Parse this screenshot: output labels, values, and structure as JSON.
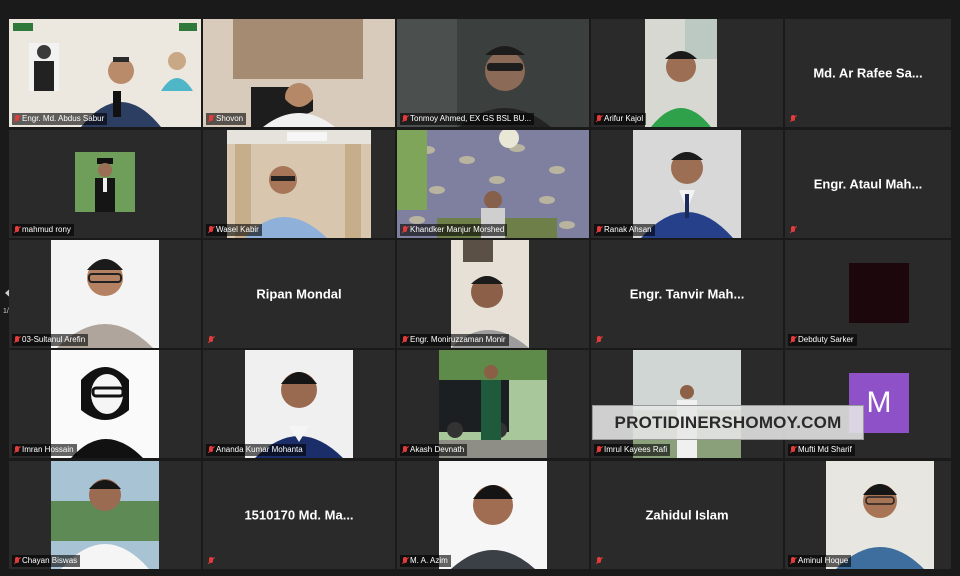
{
  "pager": {
    "page_indicator": "1/2"
  },
  "watermark": "PROTIDINERSHOMOY.COM",
  "tiles": [
    {
      "name": "Engr. Md. Abdus Sabur",
      "speaking": true
    },
    {
      "name": "Shovon"
    },
    {
      "name": "Tonmoy Ahmed, EX GS BSL BU..."
    },
    {
      "name": "Arifur Kajol"
    },
    {
      "name": "Md. Ar Rafee Sa..."
    },
    {
      "name": "mahmud rony"
    },
    {
      "name": "Wasel Kabir"
    },
    {
      "name": "Khandker Manjur Morshed"
    },
    {
      "name": "Ranak Ahsan"
    },
    {
      "name": "Engr. Ataul Mah..."
    },
    {
      "name": "03-Sultanul Arefin"
    },
    {
      "name": "Ripan Mondal"
    },
    {
      "name": "Engr. Moniruzzaman Monir"
    },
    {
      "name": "Engr. Tanvir Mah..."
    },
    {
      "name": "Debduty Sarker"
    },
    {
      "name": "Imran Hossain"
    },
    {
      "name": "Ananda Kumar Mohanta"
    },
    {
      "name": "Akash Devnath"
    },
    {
      "name": "Imrul Kayees Rafi"
    },
    {
      "name": "Mufti Md Sharif",
      "avatar_letter": "M",
      "avatar_color": "#8e51c8"
    },
    {
      "name": "Chayan Biswas"
    },
    {
      "name": "1510170 Md. Ma..."
    },
    {
      "name": "M. A. Azim"
    },
    {
      "name": "Zahidul Islam"
    },
    {
      "name": "Aminul Hoque"
    }
  ]
}
